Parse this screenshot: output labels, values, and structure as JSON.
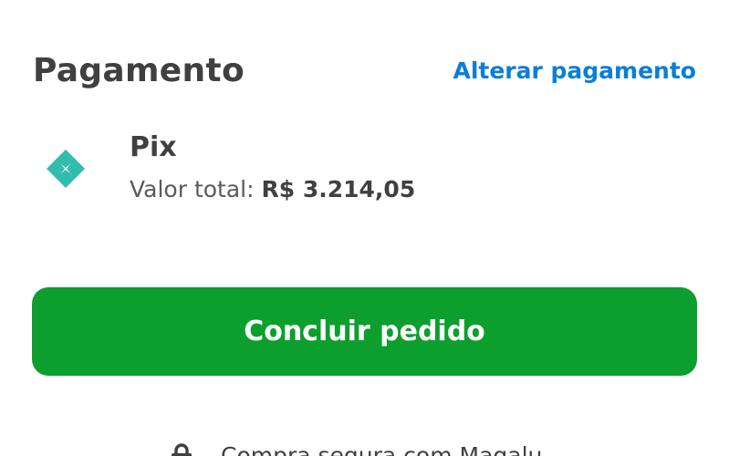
{
  "payment": {
    "title": "Pagamento",
    "change_link": "Alterar pagamento",
    "method": {
      "icon": "pix-icon",
      "icon_color": "#32bcad",
      "name": "Pix",
      "total_label": "Valor total:",
      "total_value": "R$ 3.214,05"
    }
  },
  "actions": {
    "submit_label": "Concluir pedido",
    "submit_color": "#0c9f2d"
  },
  "footer": {
    "secure_icon": "lock-icon",
    "secure_text": "Compra segura com Magalu"
  },
  "colors": {
    "text": "#404040",
    "link": "#0a7fd6"
  }
}
